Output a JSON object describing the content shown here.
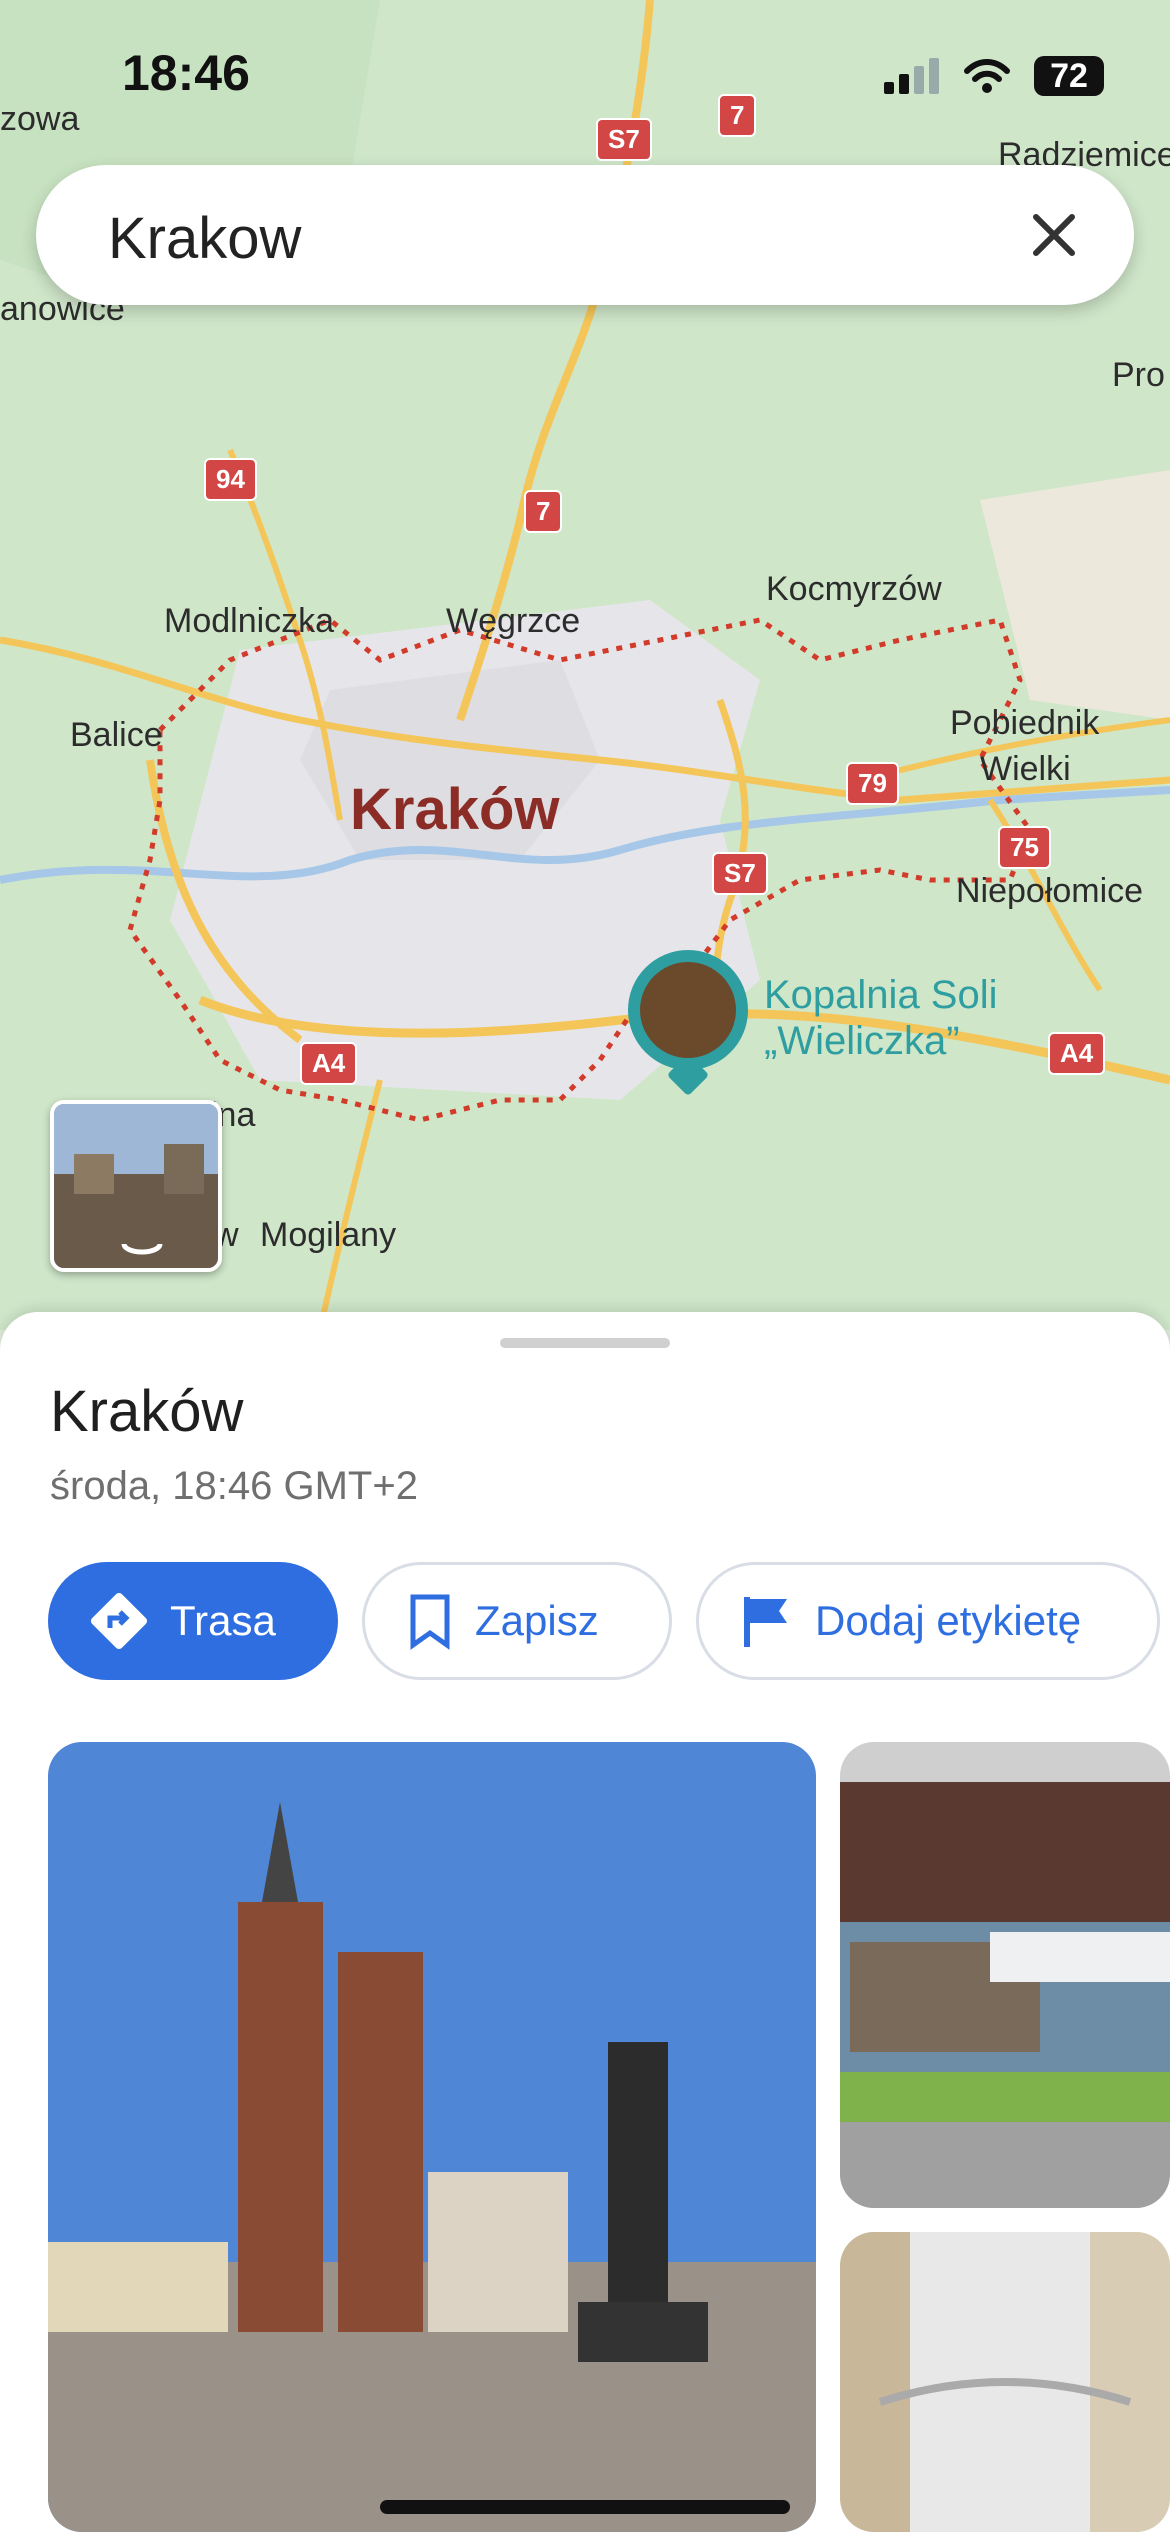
{
  "status_bar": {
    "time": "18:46",
    "battery": "72"
  },
  "search": {
    "value": "Krakow"
  },
  "map": {
    "city": "Kraków",
    "places": [
      "zowa",
      "Radziemice",
      "anowice",
      "Pro",
      "Kocmyrzów",
      "Modlniczka",
      "Węgrzce",
      "Balice",
      "Pobiednik",
      "Wielki",
      "Niepołomice",
      "ina",
      "w",
      "Mogilany"
    ],
    "roads": [
      "S7",
      "7",
      "94",
      "7",
      "79",
      "S7",
      "75",
      "A4",
      "A4"
    ],
    "poi": {
      "line1": "Kopalnia Soli",
      "line2": "„Wieliczka”"
    }
  },
  "sheet": {
    "title": "Kraków",
    "subtitle": "środa, 18:46 GMT+2",
    "buttons": {
      "directions": "Trasa",
      "save": "Zapisz",
      "label": "Dodaj etykietę"
    }
  },
  "icons": {
    "close": "close-icon",
    "directions": "directions-icon",
    "bookmark": "bookmark-icon",
    "flag": "flag-icon"
  },
  "colors": {
    "primary": "#2e6ee0",
    "city": "#8b2d26",
    "poi": "#2f9ea0",
    "road_shield": "#d24646"
  }
}
